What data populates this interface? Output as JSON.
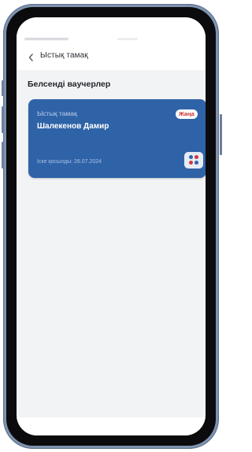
{
  "header": {
    "title": "Ыстық тамақ"
  },
  "section": {
    "title": "Белсенді ваучерлер"
  },
  "voucher": {
    "service": "Ыстық тамақ",
    "holder": "Шалекенов Дамир",
    "badge": "Жаңа",
    "activated": "Іске қосылды: 26.07.2024",
    "card_color": "#2f63a8",
    "badge_color": "#c8302c"
  },
  "icons": {
    "back": "chevron-left-icon",
    "card_action": "four-dots-icon"
  }
}
